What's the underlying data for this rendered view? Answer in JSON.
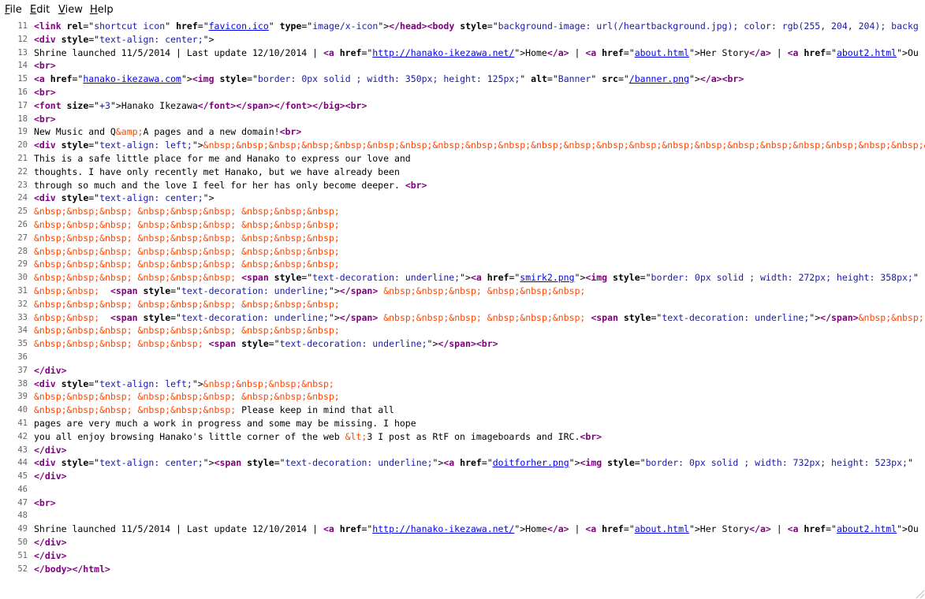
{
  "menu": {
    "file": {
      "mnemonic": "F",
      "rest": "ile"
    },
    "edit": {
      "mnemonic": "E",
      "rest": "dit"
    },
    "view": {
      "mnemonic": "V",
      "rest": "iew"
    },
    "help": {
      "mnemonic": "H",
      "rest": "elp"
    }
  },
  "colors": {
    "tag": "#800080",
    "attribute_value": "#1a1aa6",
    "entity": "#ff4500",
    "link": "#0000ee",
    "line_number": "#666666"
  },
  "lines": [
    {
      "n": "11",
      "tokens": [
        [
          "tag",
          "<link "
        ],
        [
          "attr",
          "rel"
        ],
        [
          "t",
          "=\""
        ],
        [
          "val",
          "shortcut icon"
        ],
        [
          "t",
          "\" "
        ],
        [
          "attr",
          "href"
        ],
        [
          "t",
          "=\""
        ],
        [
          "link",
          "favicon.ico"
        ],
        [
          "t",
          "\" "
        ],
        [
          "attr",
          "type"
        ],
        [
          "t",
          "=\""
        ],
        [
          "val",
          "image/x-icon"
        ],
        [
          "t",
          "\">"
        ],
        [
          "tag",
          "</head><body "
        ],
        [
          "attr",
          "style"
        ],
        [
          "t",
          "=\""
        ],
        [
          "val",
          "background-image: url(/heartbackground.jpg); color: rgb(255, 204, 204); backg"
        ]
      ]
    },
    {
      "n": "12",
      "tokens": [
        [
          "tag",
          "<div "
        ],
        [
          "attr",
          "style"
        ],
        [
          "t",
          "=\""
        ],
        [
          "val",
          "text-align: center;"
        ],
        [
          "t",
          "\">"
        ]
      ]
    },
    {
      "n": "13",
      "tokens": [
        [
          "t",
          "Shrine launched 11/5/2014 | Last update 12/10/2014 | "
        ],
        [
          "tag",
          "<a "
        ],
        [
          "attr",
          "href"
        ],
        [
          "t",
          "=\""
        ],
        [
          "link",
          "http://hanako-ikezawa.net/"
        ],
        [
          "t",
          "\">Home"
        ],
        [
          "tag",
          "</a>"
        ],
        [
          "t",
          " | "
        ],
        [
          "tag",
          "<a "
        ],
        [
          "attr",
          "href"
        ],
        [
          "t",
          "=\""
        ],
        [
          "link",
          "about.html"
        ],
        [
          "t",
          "\">Her Story"
        ],
        [
          "tag",
          "</a>"
        ],
        [
          "t",
          " | "
        ],
        [
          "tag",
          "<a "
        ],
        [
          "attr",
          "href"
        ],
        [
          "t",
          "=\""
        ],
        [
          "link",
          "about2.html"
        ],
        [
          "t",
          "\">Ou"
        ]
      ]
    },
    {
      "n": "14",
      "tokens": [
        [
          "tag",
          "<br>"
        ]
      ]
    },
    {
      "n": "15",
      "tokens": [
        [
          "tag",
          "<a "
        ],
        [
          "attr",
          "href"
        ],
        [
          "t",
          "=\""
        ],
        [
          "link",
          "hanako-ikezawa.com"
        ],
        [
          "t",
          "\">"
        ],
        [
          "tag",
          "<img "
        ],
        [
          "attr",
          "style"
        ],
        [
          "t",
          "=\""
        ],
        [
          "val",
          "border: 0px solid ; width: 350px; height: 125px;"
        ],
        [
          "t",
          "\" "
        ],
        [
          "attr",
          "alt"
        ],
        [
          "t",
          "=\""
        ],
        [
          "val",
          "Banner"
        ],
        [
          "t",
          "\" "
        ],
        [
          "attr",
          "src"
        ],
        [
          "t",
          "=\""
        ],
        [
          "link",
          "/banner.png"
        ],
        [
          "t",
          "\">"
        ],
        [
          "tag",
          "</a><br>"
        ]
      ]
    },
    {
      "n": "16",
      "tokens": [
        [
          "tag",
          "<br>"
        ]
      ]
    },
    {
      "n": "17",
      "tokens": [
        [
          "tag",
          "<font "
        ],
        [
          "attr",
          "size"
        ],
        [
          "t",
          "=\""
        ],
        [
          "val",
          "+3"
        ],
        [
          "t",
          "\">Hanako Ikezawa"
        ],
        [
          "tag",
          "</font></span></font></big><br>"
        ]
      ]
    },
    {
      "n": "18",
      "tokens": [
        [
          "tag",
          "<br>"
        ]
      ]
    },
    {
      "n": "19",
      "tokens": [
        [
          "t",
          "New Music and Q"
        ],
        [
          "ent",
          "&amp;"
        ],
        [
          "t",
          "A pages and a new domain!"
        ],
        [
          "tag",
          "<br>"
        ]
      ]
    },
    {
      "n": "20",
      "tokens": [
        [
          "tag",
          "<div "
        ],
        [
          "attr",
          "style"
        ],
        [
          "t",
          "=\""
        ],
        [
          "val",
          "text-align: left;"
        ],
        [
          "t",
          "\">"
        ],
        [
          "ent",
          "&nbsp;&nbsp;&nbsp;&nbsp;&nbsp;&nbsp;&nbsp;&nbsp;&nbsp;&nbsp;&nbsp;&nbsp;&nbsp;&nbsp;&nbsp;&nbsp;&nbsp;&nbsp;&nbsp;&nbsp;&nbsp;&nbsp;&nbsp;&nbsp;&nbsp;&nbsp;&nbsp;&nbsp;&nbsp;&nbsp;&nbsp;&nbs"
        ]
      ]
    },
    {
      "n": "21",
      "tokens": [
        [
          "t",
          "This is a safe little place for me and Hanako to express our love and"
        ]
      ]
    },
    {
      "n": "22",
      "tokens": [
        [
          "t",
          "thoughts. I have only recently met Hanako, but we have already been"
        ]
      ]
    },
    {
      "n": "23",
      "tokens": [
        [
          "t",
          "through so much and the love I feel for her has only become deeper. "
        ],
        [
          "tag",
          "<br>"
        ]
      ]
    },
    {
      "n": "24",
      "tokens": [
        [
          "tag",
          "<div "
        ],
        [
          "attr",
          "style"
        ],
        [
          "t",
          "=\""
        ],
        [
          "val",
          "text-align: center;"
        ],
        [
          "t",
          "\">"
        ]
      ]
    },
    {
      "n": "25",
      "tokens": [
        [
          "ent",
          "&nbsp;&nbsp;&nbsp; &nbsp;&nbsp;&nbsp; &nbsp;&nbsp;&nbsp;"
        ]
      ]
    },
    {
      "n": "26",
      "tokens": [
        [
          "ent",
          "&nbsp;&nbsp;&nbsp; &nbsp;&nbsp;&nbsp; &nbsp;&nbsp;&nbsp;"
        ]
      ]
    },
    {
      "n": "27",
      "tokens": [
        [
          "ent",
          "&nbsp;&nbsp;&nbsp; &nbsp;&nbsp;&nbsp; &nbsp;&nbsp;&nbsp;"
        ]
      ]
    },
    {
      "n": "28",
      "tokens": [
        [
          "ent",
          "&nbsp;&nbsp;&nbsp; &nbsp;&nbsp;&nbsp; &nbsp;&nbsp;&nbsp;"
        ]
      ]
    },
    {
      "n": "29",
      "tokens": [
        [
          "ent",
          "&nbsp;&nbsp;&nbsp; &nbsp;&nbsp;&nbsp; &nbsp;&nbsp;&nbsp;"
        ]
      ]
    },
    {
      "n": "30",
      "tokens": [
        [
          "ent",
          "&nbsp;&nbsp;&nbsp; &nbsp;&nbsp;&nbsp;"
        ],
        [
          "t",
          " "
        ],
        [
          "tag",
          "<span "
        ],
        [
          "attr",
          "style"
        ],
        [
          "t",
          "=\""
        ],
        [
          "val",
          "text-decoration: underline;"
        ],
        [
          "t",
          "\">"
        ],
        [
          "tag",
          "<a "
        ],
        [
          "attr",
          "href"
        ],
        [
          "t",
          "=\""
        ],
        [
          "link",
          "smirk2.png"
        ],
        [
          "t",
          "\">"
        ],
        [
          "tag",
          "<img "
        ],
        [
          "attr",
          "style"
        ],
        [
          "t",
          "=\""
        ],
        [
          "val",
          "border: 0px solid ; width: 272px; height: 358px;"
        ],
        [
          "t",
          "\""
        ]
      ]
    },
    {
      "n": "31",
      "tokens": [
        [
          "ent",
          "&nbsp;&nbsp;"
        ],
        [
          "t",
          "  "
        ],
        [
          "tag",
          "<span "
        ],
        [
          "attr",
          "style"
        ],
        [
          "t",
          "=\""
        ],
        [
          "val",
          "text-decoration: underline;"
        ],
        [
          "t",
          "\">"
        ],
        [
          "tag",
          "</span>"
        ],
        [
          "t",
          " "
        ],
        [
          "ent",
          "&nbsp;&nbsp;&nbsp; &nbsp;&nbsp;&nbsp;"
        ]
      ]
    },
    {
      "n": "32",
      "tokens": [
        [
          "ent",
          "&nbsp;&nbsp;&nbsp; &nbsp;&nbsp;&nbsp; &nbsp;&nbsp;&nbsp;"
        ]
      ]
    },
    {
      "n": "33",
      "tokens": [
        [
          "ent",
          "&nbsp;&nbsp;"
        ],
        [
          "t",
          "  "
        ],
        [
          "tag",
          "<span "
        ],
        [
          "attr",
          "style"
        ],
        [
          "t",
          "=\""
        ],
        [
          "val",
          "text-decoration: underline;"
        ],
        [
          "t",
          "\">"
        ],
        [
          "tag",
          "</span>"
        ],
        [
          "t",
          " "
        ],
        [
          "ent",
          "&nbsp;&nbsp;&nbsp; &nbsp;&nbsp;&nbsp;"
        ],
        [
          "t",
          " "
        ],
        [
          "tag",
          "<span "
        ],
        [
          "attr",
          "style"
        ],
        [
          "t",
          "=\""
        ],
        [
          "val",
          "text-decoration: underline;"
        ],
        [
          "t",
          "\">"
        ],
        [
          "tag",
          "</span>"
        ],
        [
          "ent",
          "&nbsp;&nbsp;"
        ]
      ]
    },
    {
      "n": "34",
      "tokens": [
        [
          "ent",
          "&nbsp;&nbsp;&nbsp; &nbsp;&nbsp;&nbsp; &nbsp;&nbsp;&nbsp;"
        ]
      ]
    },
    {
      "n": "35",
      "tokens": [
        [
          "ent",
          "&nbsp;&nbsp;&nbsp; &nbsp;&nbsp;"
        ],
        [
          "t",
          " "
        ],
        [
          "tag",
          "<span "
        ],
        [
          "attr",
          "style"
        ],
        [
          "t",
          "=\""
        ],
        [
          "val",
          "text-decoration: underline;"
        ],
        [
          "t",
          "\">"
        ],
        [
          "tag",
          "</span><br>"
        ]
      ]
    },
    {
      "n": "36",
      "tokens": []
    },
    {
      "n": "37",
      "tokens": [
        [
          "tag",
          "</div>"
        ]
      ]
    },
    {
      "n": "38",
      "tokens": [
        [
          "tag",
          "<div "
        ],
        [
          "attr",
          "style"
        ],
        [
          "t",
          "=\""
        ],
        [
          "val",
          "text-align: left;"
        ],
        [
          "t",
          "\">"
        ],
        [
          "ent",
          "&nbsp;&nbsp;&nbsp;&nbsp;"
        ]
      ]
    },
    {
      "n": "39",
      "tokens": [
        [
          "ent",
          "&nbsp;&nbsp;&nbsp; &nbsp;&nbsp;&nbsp; &nbsp;&nbsp;&nbsp;"
        ]
      ]
    },
    {
      "n": "40",
      "tokens": [
        [
          "ent",
          "&nbsp;&nbsp;&nbsp; &nbsp;&nbsp;&nbsp;"
        ],
        [
          "t",
          " Please keep in mind that all"
        ]
      ]
    },
    {
      "n": "41",
      "tokens": [
        [
          "t",
          "pages are very much a work in progress and some may be missing. I hope"
        ]
      ]
    },
    {
      "n": "42",
      "tokens": [
        [
          "t",
          "you all enjoy browsing Hanako's little corner of the web "
        ],
        [
          "ent",
          "&lt;"
        ],
        [
          "t",
          "3 I post as RtF on imageboards and IRC."
        ],
        [
          "tag",
          "<br>"
        ]
      ]
    },
    {
      "n": "43",
      "tokens": [
        [
          "tag",
          "</div>"
        ]
      ]
    },
    {
      "n": "44",
      "tokens": [
        [
          "tag",
          "<div "
        ],
        [
          "attr",
          "style"
        ],
        [
          "t",
          "=\""
        ],
        [
          "val",
          "text-align: center;"
        ],
        [
          "t",
          "\">"
        ],
        [
          "tag",
          "<span "
        ],
        [
          "attr",
          "style"
        ],
        [
          "t",
          "=\""
        ],
        [
          "val",
          "text-decoration: underline;"
        ],
        [
          "t",
          "\">"
        ],
        [
          "tag",
          "<a "
        ],
        [
          "attr",
          "href"
        ],
        [
          "t",
          "=\""
        ],
        [
          "link",
          "doitforher.png"
        ],
        [
          "t",
          "\">"
        ],
        [
          "tag",
          "<img "
        ],
        [
          "attr",
          "style"
        ],
        [
          "t",
          "=\""
        ],
        [
          "val",
          "border: 0px solid ; width: 732px; height: 523px;"
        ],
        [
          "t",
          "\""
        ]
      ]
    },
    {
      "n": "45",
      "tokens": [
        [
          "tag",
          "</div>"
        ]
      ]
    },
    {
      "n": "46",
      "tokens": []
    },
    {
      "n": "47",
      "tokens": [
        [
          "tag",
          "<br>"
        ]
      ]
    },
    {
      "n": "48",
      "tokens": []
    },
    {
      "n": "49",
      "tokens": [
        [
          "t",
          "Shrine launched 11/5/2014 | Last update 12/10/2014 | "
        ],
        [
          "tag",
          "<a "
        ],
        [
          "attr",
          "href"
        ],
        [
          "t",
          "=\""
        ],
        [
          "link",
          "http://hanako-ikezawa.net/"
        ],
        [
          "t",
          "\">Home"
        ],
        [
          "tag",
          "</a>"
        ],
        [
          "t",
          " | "
        ],
        [
          "tag",
          "<a "
        ],
        [
          "attr",
          "href"
        ],
        [
          "t",
          "=\""
        ],
        [
          "link",
          "about.html"
        ],
        [
          "t",
          "\">Her Story"
        ],
        [
          "tag",
          "</a>"
        ],
        [
          "t",
          " | "
        ],
        [
          "tag",
          "<a "
        ],
        [
          "attr",
          "href"
        ],
        [
          "t",
          "=\""
        ],
        [
          "link",
          "about2.html"
        ],
        [
          "t",
          "\">Ou"
        ]
      ]
    },
    {
      "n": "50",
      "tokens": [
        [
          "tag",
          "</div>"
        ]
      ]
    },
    {
      "n": "51",
      "tokens": [
        [
          "tag",
          "</div>"
        ]
      ]
    },
    {
      "n": "52",
      "tokens": [
        [
          "tag",
          "</body></html>"
        ]
      ]
    }
  ]
}
